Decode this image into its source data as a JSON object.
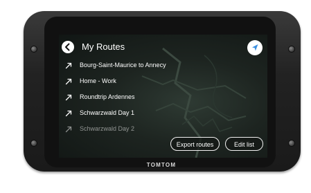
{
  "header": {
    "title": "My Routes"
  },
  "routes": [
    {
      "label": "Bourg-Saint-Maurice to Annecy",
      "icon": "route-arrow-icon",
      "faded": false
    },
    {
      "label": "Home - Work",
      "icon": "route-arrow-icon",
      "faded": false
    },
    {
      "label": "Roundtrip Ardennes",
      "icon": "route-arrow-icon",
      "faded": false
    },
    {
      "label": "Schwarzwald Day 1",
      "icon": "route-arrow-icon",
      "faded": false
    },
    {
      "label": "Schwarzwald Day 2",
      "icon": "route-arrow-icon",
      "faded": true
    }
  ],
  "actions": {
    "export_label": "Export routes",
    "edit_label": "Edit list"
  },
  "device": {
    "brand": "TOMTOM"
  },
  "colors": {
    "accent_blue": "#3a8fe0",
    "screen_background": "#1d2420",
    "text": "#ffffff"
  }
}
